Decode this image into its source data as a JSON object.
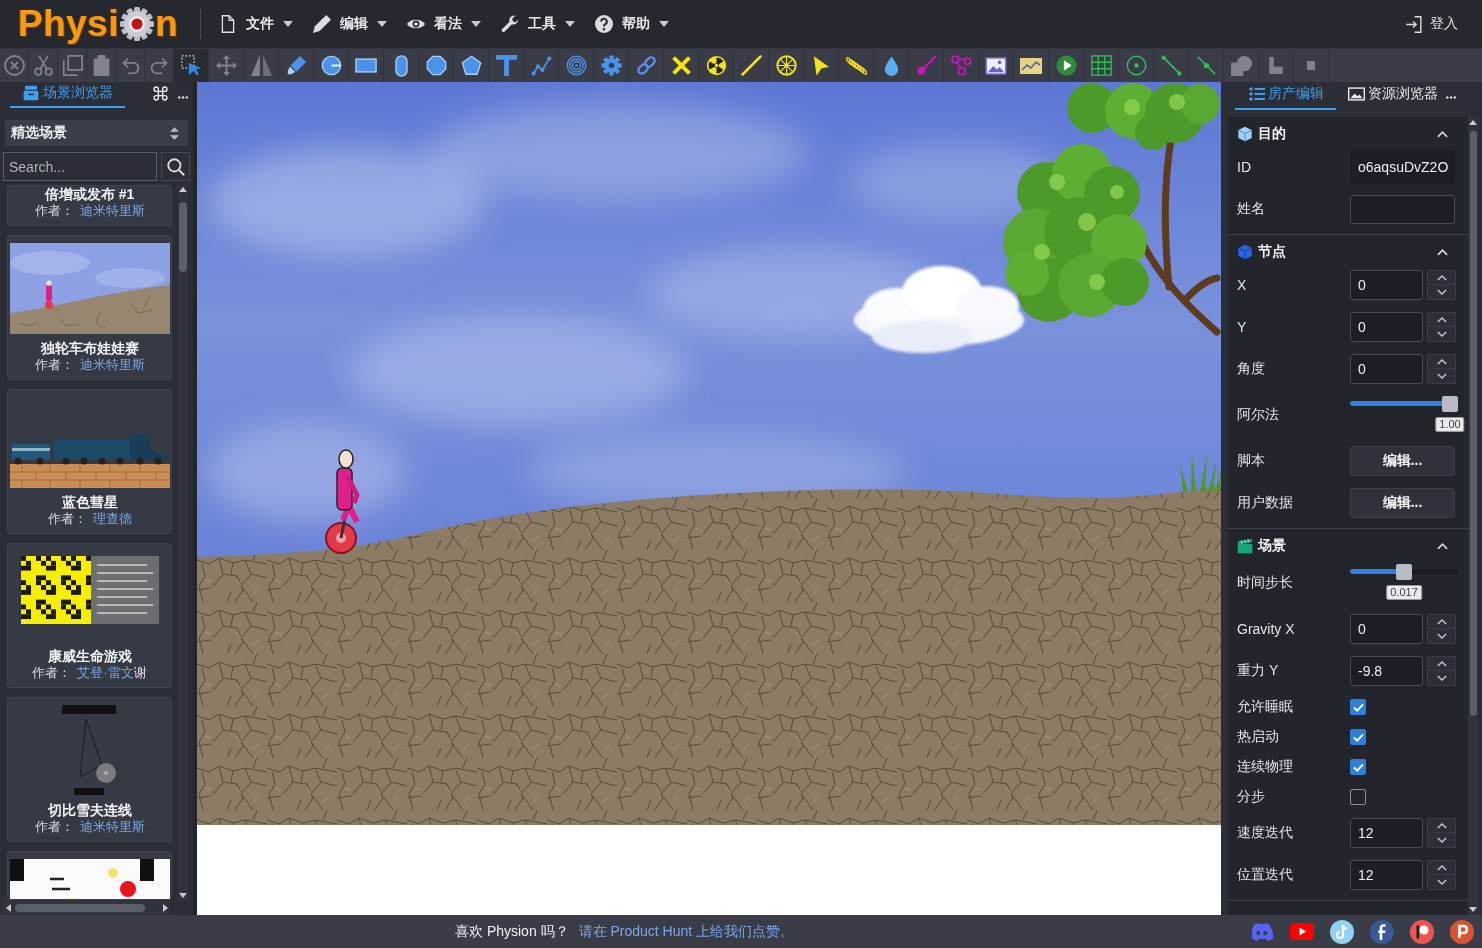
{
  "header": {
    "logo_start": "Physi",
    "logo_end": "n",
    "menus": [
      {
        "label": "文件"
      },
      {
        "label": "编辑"
      },
      {
        "label": "看法"
      },
      {
        "label": "工具"
      },
      {
        "label": "帮助"
      }
    ],
    "login": "登入"
  },
  "toolbar": {
    "tools": [
      {
        "selected": false,
        "disabled": true
      },
      {
        "selected": false,
        "disabled": true
      },
      {
        "selected": false,
        "disabled": true
      },
      {
        "selected": false,
        "disabled": true
      },
      {
        "selected": false,
        "disabled": true
      },
      {
        "selected": false,
        "disabled": true
      },
      {
        "selected": true,
        "disabled": false
      },
      {
        "selected": false,
        "disabled": true
      },
      {
        "selected": false,
        "disabled": true
      },
      {
        "selected": false,
        "disabled": false
      },
      {
        "selected": false,
        "disabled": false
      },
      {
        "selected": false,
        "disabled": false
      },
      {
        "selected": false,
        "disabled": false
      },
      {
        "selected": false,
        "disabled": false
      },
      {
        "selected": false,
        "disabled": false
      },
      {
        "selected": false,
        "disabled": false
      },
      {
        "selected": false,
        "disabled": false
      },
      {
        "selected": false,
        "disabled": false
      },
      {
        "selected": false,
        "disabled": false
      },
      {
        "selected": false,
        "disabled": false
      },
      {
        "selected": false,
        "disabled": false
      },
      {
        "selected": false,
        "disabled": false
      },
      {
        "selected": false,
        "disabled": false
      },
      {
        "selected": false,
        "disabled": false
      },
      {
        "selected": false,
        "disabled": false
      },
      {
        "selected": false,
        "disabled": false
      },
      {
        "selected": false,
        "disabled": false
      },
      {
        "selected": false,
        "disabled": false
      },
      {
        "selected": false,
        "disabled": false
      },
      {
        "selected": false,
        "disabled": false
      },
      {
        "selected": false,
        "disabled": false
      },
      {
        "selected": false,
        "disabled": false
      },
      {
        "selected": false,
        "disabled": false
      },
      {
        "selected": false,
        "disabled": false
      },
      {
        "selected": false,
        "disabled": false
      },
      {
        "selected": false,
        "disabled": false
      },
      {
        "selected": false,
        "disabled": true
      },
      {
        "selected": false,
        "disabled": true
      },
      {
        "selected": false,
        "disabled": true
      }
    ]
  },
  "scene_browser": {
    "tabs": [
      {
        "label": "场景浏览器",
        "selected": true
      }
    ],
    "filter": "精选场景",
    "search": {
      "placeholder": "Search..."
    },
    "scenes": [
      {
        "kind": "partial-top",
        "title": "倍增或发布 #1",
        "author_label": "作者：",
        "author": "迪米特里斯"
      },
      {
        "kind": "full",
        "title": "独轮车布娃娃赛",
        "author_label": "作者：",
        "author": "迪米特里斯"
      },
      {
        "kind": "full",
        "title": "蓝色彗星",
        "author_label": "作者：",
        "author": "理查德"
      },
      {
        "kind": "full",
        "title": "康威生命游戏",
        "author_label": "作者：",
        "author": "艾登·雷文",
        "author_suffix": "谢"
      },
      {
        "kind": "full",
        "title": "切比雪夫连线",
        "author_label": "作者：",
        "author": "迪米特里斯"
      },
      {
        "kind": "partial-bottom"
      }
    ]
  },
  "right_panel": {
    "tabs": [
      {
        "label": "房产编辑",
        "selected": true
      },
      {
        "label": "资源浏览器",
        "selected": false
      }
    ],
    "sections": [
      {
        "title": "目的",
        "expanded": true,
        "rows": [
          {
            "kind": "readonly",
            "label": "ID",
            "value": "o6aqsuDvZ2O"
          },
          {
            "kind": "text",
            "label": "姓名"
          }
        ]
      },
      {
        "title": "节点",
        "expanded": true,
        "rows": [
          {
            "kind": "number",
            "label": "X",
            "value": "0"
          },
          {
            "kind": "number",
            "label": "Y",
            "value": "0"
          },
          {
            "kind": "number",
            "label": "角度",
            "value": "0"
          },
          {
            "kind": "slider",
            "label": "阿尔法",
            "level": 1,
            "reading": "1.00"
          },
          {
            "kind": "button",
            "label": "脚本",
            "button": "编辑..."
          },
          {
            "kind": "button",
            "label": "用户数据",
            "button": "编辑..."
          }
        ]
      },
      {
        "title": "场景",
        "expanded": true,
        "rows": [
          {
            "kind": "slider",
            "label": "时间步长",
            "level": 0.5,
            "reading": "0.017"
          },
          {
            "kind": "number",
            "label": "Gravity X",
            "value": "0"
          },
          {
            "kind": "number",
            "label": "重力 Y",
            "value": "-9.8"
          },
          {
            "kind": "checkbox",
            "label": "允许睡眠",
            "checked": true
          },
          {
            "kind": "checkbox",
            "label": "热启动",
            "checked": true
          },
          {
            "kind": "checkbox",
            "label": "连续物理",
            "checked": true
          },
          {
            "kind": "checkbox",
            "label": "分步",
            "checked": false
          },
          {
            "kind": "number",
            "label": "速度迭代",
            "value": "12"
          },
          {
            "kind": "number",
            "label": "位置迭代",
            "value": "12"
          }
        ]
      }
    ]
  },
  "footer": {
    "question": "喜欢 Physion 吗？",
    "link": "请在 Product Hunt 上给我们点赞。"
  }
}
